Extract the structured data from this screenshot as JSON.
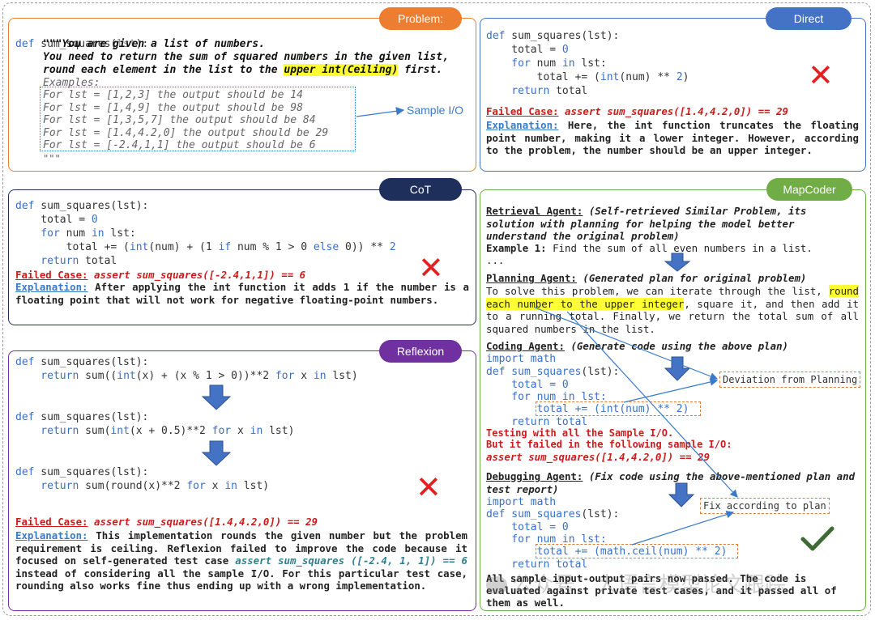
{
  "badges": {
    "problem": "Problem:",
    "direct": "Direct",
    "cot": "CoT",
    "mapcoder": "MapCoder",
    "reflexion": "Reflexion"
  },
  "problem": {
    "sig_def": "def",
    "sig_name": " sum_squares(",
    "sig_arg": "lst",
    "sig_end": "):",
    "doc1": "\"\"\"You are given a list of numbers.",
    "doc2": "You need to return the sum of squared numbers in the given list,",
    "doc3a": "round each element in the list to the ",
    "doc3hl": "upper int(Ceiling)",
    "doc3b": " first.",
    "examples": "Examples:",
    "ex": [
      "For lst = [1,2,3] the output should be 14",
      "For lst = [1,4,9] the output should be 98",
      "For lst = [1,3,5,7] the output should be 84",
      "For lst = [1.4,4.2,0] the output should be 29",
      "For lst = [-2.4,1,1] the output should be 6"
    ],
    "docend": "\"\"\"",
    "sample_label": "Sample I/O"
  },
  "direct": {
    "l1": "def sum_squares(lst):",
    "l2a": "    total = ",
    "l2b": "0",
    "l3a": "    for",
    "l3b": " num ",
    "l3c": "in",
    "l3d": " lst:",
    "l4a": "        total += (",
    "l4b": "int",
    "l4c": "(num) ** ",
    "l4d": "2",
    ")": ")",
    "l5a": "    return",
    "l5b": " total",
    "fail_label": "Failed Case:",
    "fail_code": " assert sum_squares([1.4,4.2,0]) == 29",
    "expl_label": "Explanation:",
    "expl_text": " Here, the int function truncates the floating point number, making it a lower integer. However, according to the problem, the number should be an upper integer."
  },
  "cot": {
    "l1": "def sum_squares(lst):",
    "l2": "    total = ",
    "l2n": "0",
    "l3a": "    for",
    "l3b": " num ",
    "l3c": "in",
    "l3d": " lst:",
    "l4a": "        total += (",
    "l4b": "int",
    "l4c": "(num) + (1 ",
    "l4d": "if",
    "l4e": " num % 1 > 0 ",
    "l4f": "else",
    "l4g": " 0)) ** ",
    "l4h": "2",
    "l5a": "    return",
    "l5b": " total",
    "fail_label": "Failed Case:",
    "fail_code": " assert sum_squares([-2.4,1,1]) == 6",
    "expl_label": "Explanation:",
    "expl_text": " After applying the int function it adds 1 if the number is a floating point that will not work for negative floating-point numbers."
  },
  "reflexion": {
    "c1a": "def sum_squares(lst):",
    "c1b_1": "    return sum((",
    "c1b_2": "int",
    "c1b_3": "(x) + (x % 1 > 0))**2 ",
    "c1b_4": "for",
    "c1b_5": " x ",
    "c1b_6": "in",
    "c1b_7": " lst)",
    "c2a": "def sum_squares(lst):",
    "c2b_1": "    return sum(",
    "c2b_2": "int",
    "c2b_3": "(x + 0.5)**2 ",
    "c2b_4": "for",
    "c2b_5": " x ",
    "c2b_6": "in",
    "c2b_7": " lst)",
    "c3a": "def sum_squares(lst):",
    "c3b_1": "    return sum(round(x)**2 ",
    "c3b_2": "for",
    "c3b_3": " x ",
    "c3b_4": "in",
    "c3b_5": " lst)",
    "fail_label": "Failed Case:",
    "fail_code": " assert sum_squares([1.4,4.2,0]) == 29",
    "expl_label": "Explanation:",
    "expl_1": " This implementation rounds the given number but the problem requirement is ceiling. Reflexion failed to improve the code because it focused on self-generated test case ",
    "expl_2": "assert sum_squares ([-2.4, 1, 1]) == 6",
    "expl_3": " instead of considering all the sample I/O. For this particular test case, rounding also works fine thus ending up with a wrong implementation."
  },
  "mapcoder": {
    "ret_label": "Retrieval Agent:",
    "ret_text": " (Self-retrieved Similar Problem, its solution with planning for helping the model better understand the original problem)",
    "ex_label": "Example 1:",
    "ex_text": " Find the sum of all even numbers in a list.",
    "ellipsis": "...",
    "plan_label": "Planning Agent:",
    "plan_text": " (Generated plan for original problem)",
    "plan_1": "To solve this problem, we can iterate through the list, ",
    "plan_hl": "round each number to the upper integer",
    "plan_2": ", square it, and then add it to a running total. Finally, we return the total sum of all squared numbers in the list.",
    "code_label": "Coding Agent:",
    "code_text": " (Generate code using the above plan)",
    "cc": [
      "import math",
      "def sum_squares(lst):",
      "    total = 0",
      "    for num in lst:",
      "        total += (int(num) ** 2)",
      "    return total"
    ],
    "test1": "Testing with all the Sample I/O.",
    "test2": "But it failed in the following sample I/O:",
    "test3": "assert sum_squares([1.4,4.2,0]) == 29",
    "dev_label": "Deviation from Planning",
    "dbg_label": "Debugging Agent:",
    "dbg_text": " (Fix code using the above-mentioned plan and test report)",
    "dc": [
      "import math",
      "def sum_squares(lst):",
      "    total = 0",
      "    for num in lst:",
      "        total += (math.ceil(num) ** 2)",
      "    return total"
    ],
    "fix_label": "Fix according to plan",
    "end": "All sample input-output pairs now passed. The code is evaluated against private test cases, and it passed all of them as well."
  },
  "watermark": "公众号：大语言模型论文跟踪",
  "colors": {
    "problem": "#ed7d31",
    "direct": "#4472c4",
    "cot": "#1f2f5c",
    "mapcoder": "#70ad47",
    "reflexion": "#7030a0"
  }
}
